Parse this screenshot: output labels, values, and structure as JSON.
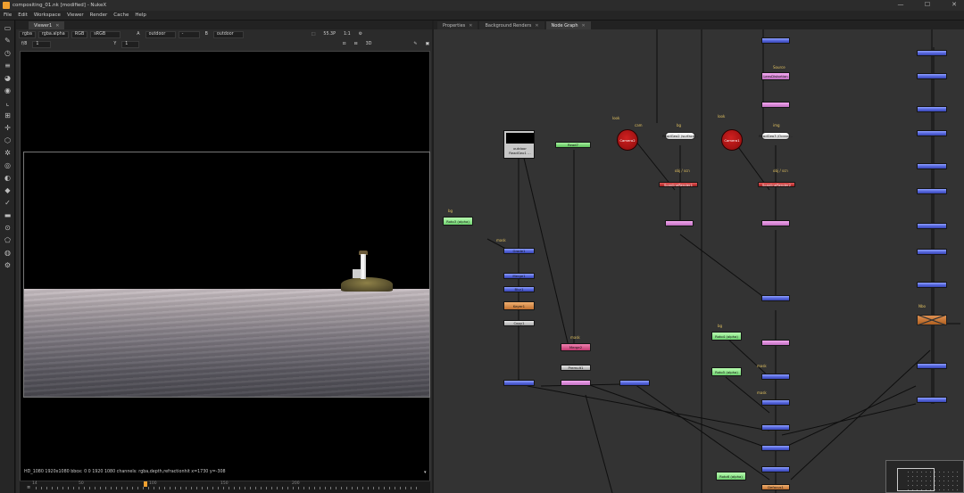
{
  "window": {
    "title": "compositing_01.nk [modified] - NukeX",
    "controls": [
      "—",
      "☐",
      "✕"
    ]
  },
  "menu": [
    "File",
    "Edit",
    "Workspace",
    "Viewer",
    "Render",
    "Cache",
    "Help"
  ],
  "viewer": {
    "tab_label": "Viewer1",
    "row1": {
      "channels": "rgba",
      "layer": "rgba.alpha",
      "display": "RGB",
      "colorspace": "sRGB",
      "input_a_label": "A",
      "input_a": "outdoor",
      "minus": "-",
      "input_b_label": "B",
      "input_b": "outdoor",
      "proxy": "55.3P",
      "ratio": "1:1",
      "mode": "3D"
    },
    "row2": {
      "fstop_label": "f/8",
      "frame": "1",
      "y_label": "Y",
      "y_value": "1"
    },
    "status_line": "HD_1080 1920x1080  bbox: 0 0 1920 1080 channels: rgba,depth,refractionhit  x=1730 y=-308",
    "timeline_ticks": [
      "14",
      "50",
      "100",
      "150",
      "200"
    ]
  },
  "right_panel": {
    "tabs": [
      "Properties",
      "Background Renders",
      "Node Graph"
    ],
    "active_tab": "Node Graph"
  },
  "graph": {
    "nodes": [
      {
        "name": "outdoor-thumbnail",
        "label": "outdoor\nReadGeo1 ..."
      },
      {
        "name": "read-node-top",
        "label": "Read7"
      },
      {
        "name": "roto3",
        "label": "Roto3\n(alpha)"
      },
      {
        "name": "grade-1",
        "label": "Grade1"
      },
      {
        "name": "merge-1",
        "label": "Merge1"
      },
      {
        "name": "blur-1",
        "label": "Blur1"
      },
      {
        "name": "keyer-1",
        "label": "Keyer1"
      },
      {
        "name": "copy-1",
        "label": "Copy1"
      },
      {
        "name": "premult-1",
        "label": "Premult1"
      },
      {
        "name": "merge-mag",
        "label": "Merge2"
      },
      {
        "name": "camera2",
        "label": "Camera2"
      },
      {
        "name": "readgeo2",
        "label": "ReadGeo2\n/surface..."
      },
      {
        "name": "scanlinerender1",
        "label": "ScanlineRender1"
      },
      {
        "name": "camera1",
        "label": "Camera1"
      },
      {
        "name": "readgeo3",
        "label": "ReadGeo3\n/Ocean..."
      },
      {
        "name": "scanlinerender2",
        "label": "ScanlineRender2"
      },
      {
        "name": "roto4",
        "label": "Roto4\n(alpha)"
      },
      {
        "name": "roto5",
        "label": "Roto5\n(alpha)"
      },
      {
        "name": "roto6",
        "label": "Roto6\n(alpha)"
      },
      {
        "name": "defocus-1",
        "label": "Defocus1"
      },
      {
        "name": "lens-distortion",
        "label": "LensDistortion"
      },
      {
        "name": "flare-orange",
        "label": "Flare1"
      }
    ],
    "input_labels": [
      "bg",
      "mask",
      "look",
      "cam",
      "bg",
      "obj / scn",
      "bg",
      "look",
      "img",
      "cam",
      "Source",
      "mask",
      "mask",
      "mask",
      "bg",
      "Nbo"
    ]
  },
  "colors": {
    "accent": "#f0a030",
    "node_merge": "#5060d8",
    "node_grade": "#c070c0",
    "node_roto": "#5cc05a",
    "node_camera": "#a02020",
    "background_graph": "#333333"
  }
}
